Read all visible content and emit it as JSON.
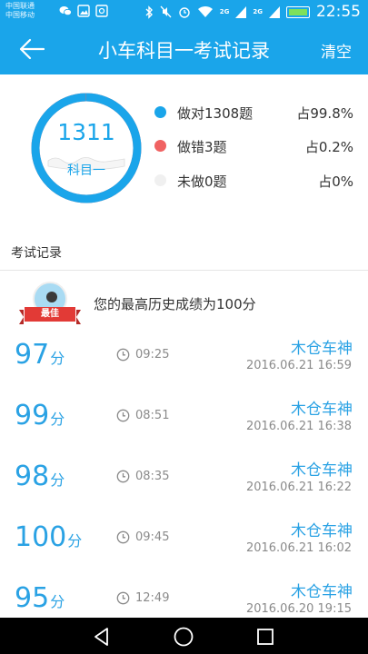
{
  "status_bar": {
    "carrier_1": "中国联通",
    "carrier_2": "中国移动",
    "sig1": "2G",
    "sig2": "2G",
    "time": "22:55"
  },
  "header": {
    "title": "小车科目一考试记录",
    "clear_label": "清空"
  },
  "summary": {
    "total": "1311",
    "subject": "科目一",
    "correct_ratio": 0.998,
    "legend": [
      {
        "label": "做对1308题",
        "pct": "占99.8%",
        "color": "#1aa5ea"
      },
      {
        "label": "做错3题",
        "pct": "占0.2%",
        "color": "#f06262"
      },
      {
        "label": "未做0题",
        "pct": "占0%",
        "color": "#f0f0f0"
      }
    ]
  },
  "section_label": "考试记录",
  "best": {
    "badge": "最佳",
    "text": "您的最高历史成绩为100分"
  },
  "records": [
    {
      "score": "97",
      "unit": "分",
      "duration": "09:25",
      "name": "木仓车神",
      "date": "2016.06.21  16:59"
    },
    {
      "score": "99",
      "unit": "分",
      "duration": "08:51",
      "name": "木仓车神",
      "date": "2016.06.21  16:38"
    },
    {
      "score": "98",
      "unit": "分",
      "duration": "08:35",
      "name": "木仓车神",
      "date": "2016.06.21  16:22"
    },
    {
      "score": "100",
      "unit": "分",
      "duration": "09:45",
      "name": "木仓车神",
      "date": "2016.06.21  16:02"
    },
    {
      "score": "95",
      "unit": "分",
      "duration": "12:49",
      "name": "木仓车神",
      "date": "2016.06.20  19:15"
    }
  ],
  "icons": {
    "back": "arrow-left-icon",
    "clock": "clock-icon",
    "nav_back": "triangle-back-icon",
    "nav_home": "circle-home-icon",
    "nav_recent": "square-recent-icon"
  }
}
